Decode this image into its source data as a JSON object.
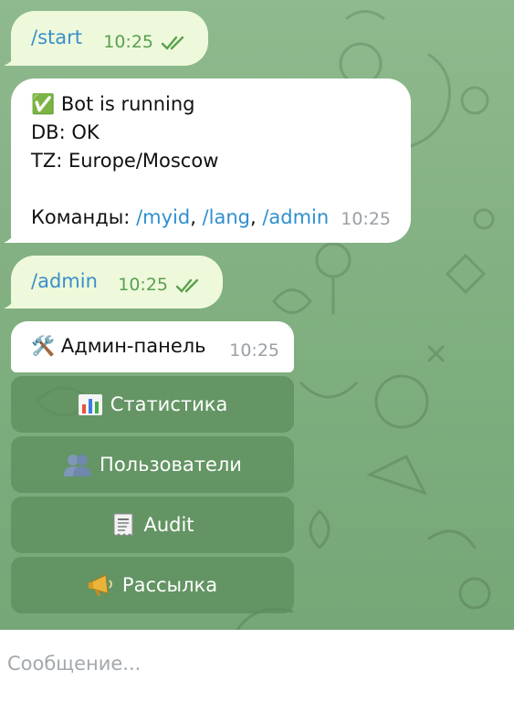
{
  "messages": [
    {
      "direction": "outgoing",
      "text": "/start",
      "time": "10:25",
      "status": "read"
    },
    {
      "direction": "incoming",
      "lines": [
        "✅ Bot is running",
        "DB: OK",
        "TZ: Europe/Moscow",
        "",
        "Команды: "
      ],
      "commands": [
        "/myid",
        "/lang",
        "/admin"
      ],
      "separator": ", ",
      "time": "10:25"
    },
    {
      "direction": "outgoing",
      "text": "/admin",
      "time": "10:25",
      "status": "read"
    },
    {
      "direction": "incoming",
      "text": "🛠️ Админ-панель",
      "time": "10:25"
    }
  ],
  "keyboard": [
    {
      "icon": "bar-chart-icon",
      "label": "Статистика"
    },
    {
      "icon": "users-icon",
      "label": "Пользователи"
    },
    {
      "icon": "receipt-icon",
      "label": "Audit"
    },
    {
      "icon": "megaphone-icon",
      "label": "Рассылка"
    }
  ],
  "composer": {
    "placeholder": "Сообщение..."
  },
  "colors": {
    "background": "#7fae7f",
    "outgoing_bubble": "#eef9dc",
    "incoming_bubble": "#ffffff",
    "link": "#2f8fcf",
    "read_check": "#5aa04f",
    "keyboard_button": "#5c8c5c"
  }
}
